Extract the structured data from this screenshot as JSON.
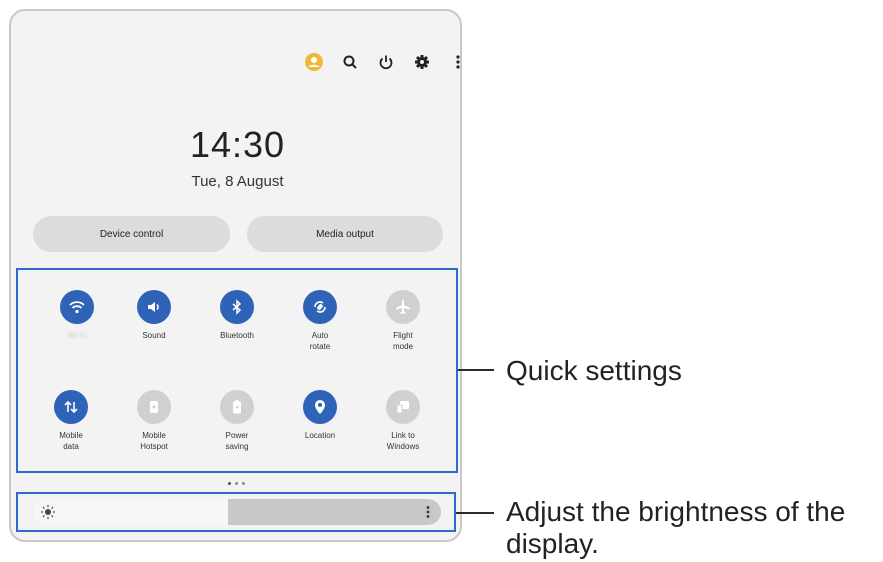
{
  "header": {
    "icons": [
      "account-icon",
      "search-icon",
      "power-icon",
      "settings-icon",
      "more-options-icon"
    ],
    "accent": "#f0b73a"
  },
  "clock": {
    "time": "14:30",
    "date": "Tue, 8 August"
  },
  "buttons": {
    "device_control": "Device control",
    "media_output": "Media output"
  },
  "quick_settings": {
    "active_color": "#2e63b8",
    "inactive_color": "#d0d0d0",
    "tiles": [
      {
        "label": "Wi-Fi",
        "state": "on",
        "icon": "wifi-icon"
      },
      {
        "label": "Sound",
        "state": "on",
        "icon": "sound-icon"
      },
      {
        "label": "Bluetooth",
        "state": "on",
        "icon": "bluetooth-icon"
      },
      {
        "label": "Auto\nrotate",
        "state": "on",
        "icon": "auto-rotate-icon"
      },
      {
        "label": "Flight\nmode",
        "state": "off",
        "icon": "airplane-icon"
      },
      {
        "label": "Mobile\ndata",
        "state": "on",
        "icon": "mobile-data-icon"
      },
      {
        "label": "Mobile\nHotspot",
        "state": "off",
        "icon": "hotspot-icon"
      },
      {
        "label": "Power\nsaving",
        "state": "off",
        "icon": "battery-icon"
      },
      {
        "label": "Location",
        "state": "on",
        "icon": "location-icon"
      },
      {
        "label": "Link to\nWindows",
        "state": "off",
        "icon": "link-to-windows-icon"
      }
    ]
  },
  "pager": {
    "pages": 3,
    "current": 1
  },
  "brightness": {
    "level": 0.48,
    "icon": "brightness-icon"
  },
  "callouts": {
    "quick_settings": "Quick settings",
    "brightness_line1": "Adjust the brightness of the",
    "brightness_line2": "display."
  }
}
